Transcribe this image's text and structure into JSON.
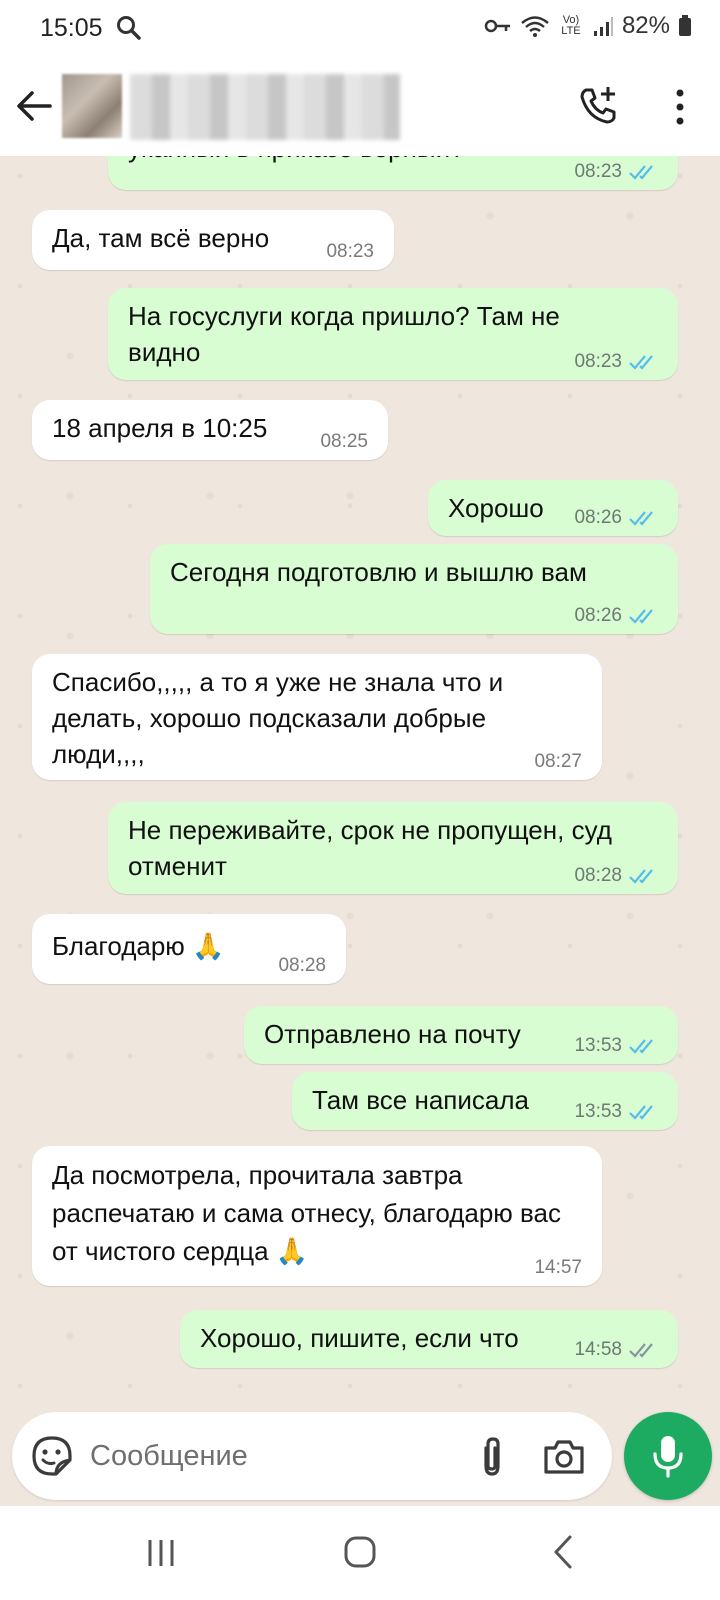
{
  "status_bar": {
    "time": "15:05",
    "battery": "82%",
    "network": "Vo) LTE"
  },
  "header": {
    "contact_name": ""
  },
  "messages": [
    {
      "dir": "out",
      "text": "уканный в приказе верный?",
      "time": "08:23",
      "read": true
    },
    {
      "dir": "in",
      "text": "Да, там всё верно",
      "time": "08:23"
    },
    {
      "dir": "out",
      "text": "На госуслуги когда пришло? Там не видно",
      "time": "08:23",
      "read": true
    },
    {
      "dir": "in",
      "text": "18 апреля в 10:25",
      "time": "08:25"
    },
    {
      "dir": "out",
      "text": "Хорошо",
      "time": "08:26",
      "read": true
    },
    {
      "dir": "out",
      "text": "Сегодня подготовлю и вышлю вам",
      "time": "08:26",
      "read": true
    },
    {
      "dir": "in",
      "text": "Спасибо,,,,, а то я уже не знала что и делать, хорошо подсказали добрые люди,,,,",
      "time": "08:27"
    },
    {
      "dir": "out",
      "text": "Не переживайте, срок не пропущен, суд отменит",
      "time": "08:28",
      "read": true
    },
    {
      "dir": "in",
      "text": "Благодарю 🙏",
      "time": "08:28"
    },
    {
      "dir": "out",
      "text": "Отправлено на почту",
      "time": "13:53",
      "read": true
    },
    {
      "dir": "out",
      "text": "Там все написала",
      "time": "13:53",
      "read": true
    },
    {
      "dir": "in",
      "text": "Да посмотрела, прочитала завтра распечатаю и сама отнесу, благодарю вас от чистого сердца 🙏",
      "time": "14:57"
    },
    {
      "dir": "out",
      "text": "Хорошо, пишите, если что",
      "time": "14:58",
      "read": false
    }
  ],
  "input": {
    "placeholder": "Сообщение"
  },
  "colors": {
    "outgoing_bubble": "#d9fdd3",
    "incoming_bubble": "#ffffff",
    "read_ticks": "#53bdeb",
    "unread_ticks": "#8696a0",
    "mic_button": "#1daa61",
    "chat_bg": "#efe7de"
  }
}
